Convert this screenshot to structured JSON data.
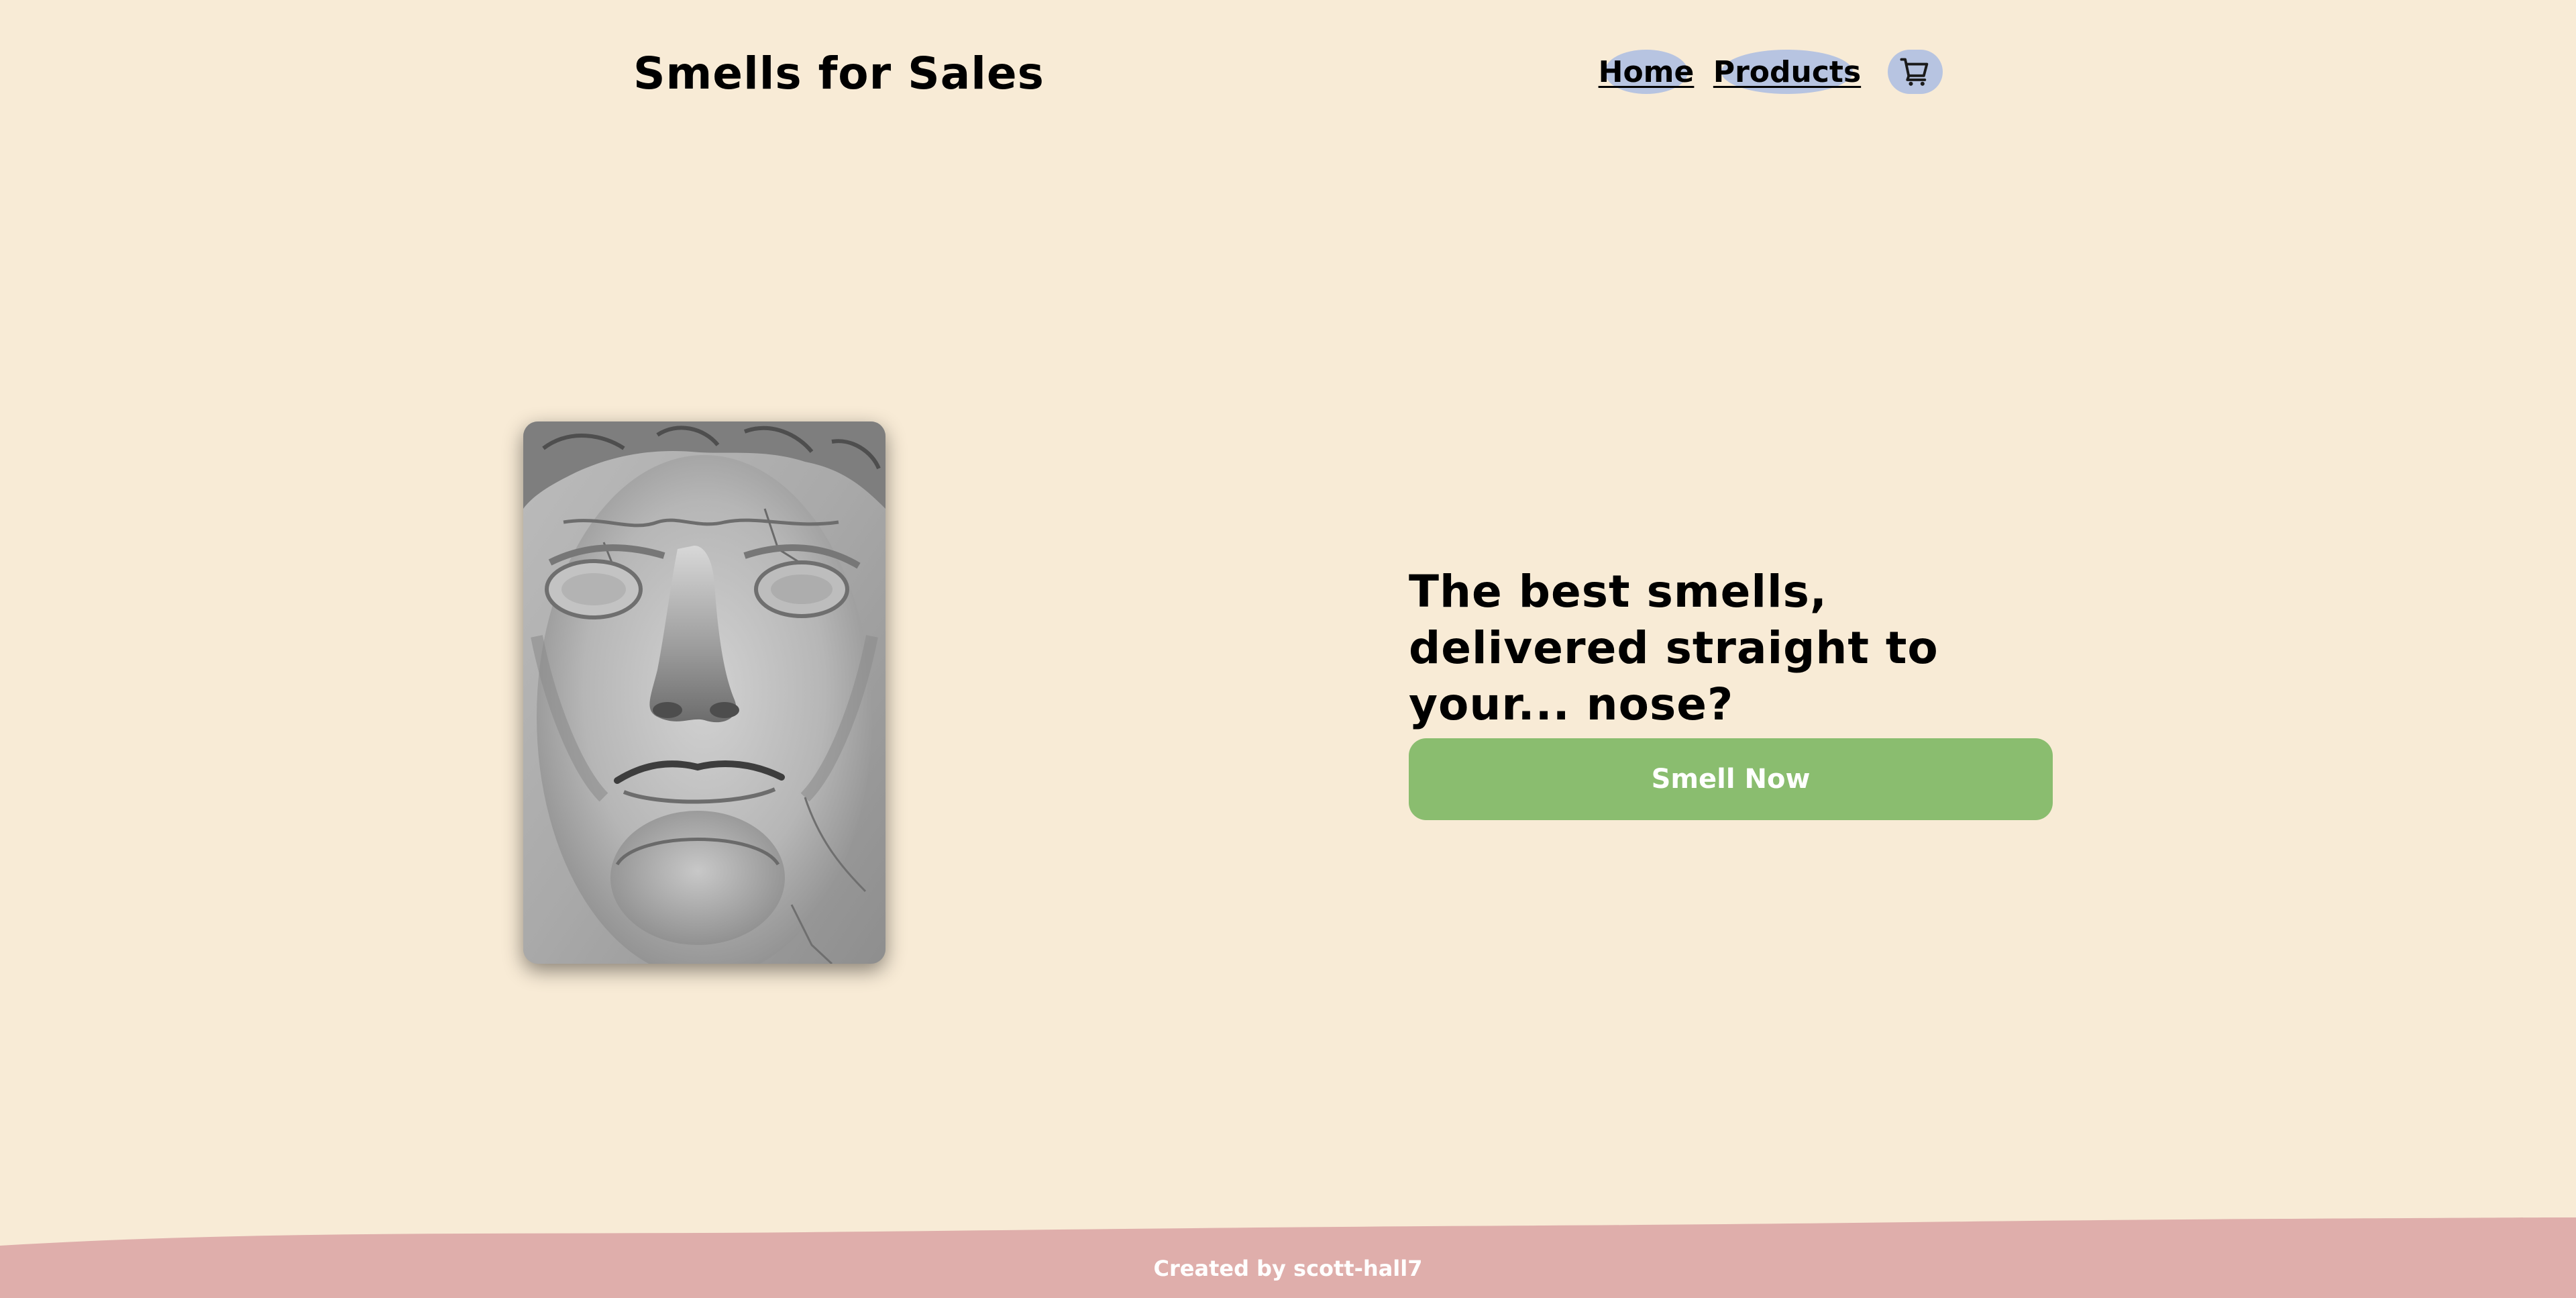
{
  "app": {
    "title": "Smells for Sales"
  },
  "nav": {
    "items": [
      {
        "label": "Home"
      },
      {
        "label": "Products"
      }
    ],
    "cart_icon": "shopping-cart-icon"
  },
  "hero": {
    "image_icon": "statue-face-image",
    "heading": "The best smells, delivered straight to your... nose?",
    "cta_label": "Smell Now"
  },
  "footer": {
    "credit": "Created by scott-hall7"
  },
  "colors": {
    "background": "#f8ebd6",
    "nav_pill": "#b7c4e1",
    "cta": "#8abd6f",
    "footer": "#dfaeab",
    "text": "#000000",
    "footer_text": "#ffffff"
  }
}
